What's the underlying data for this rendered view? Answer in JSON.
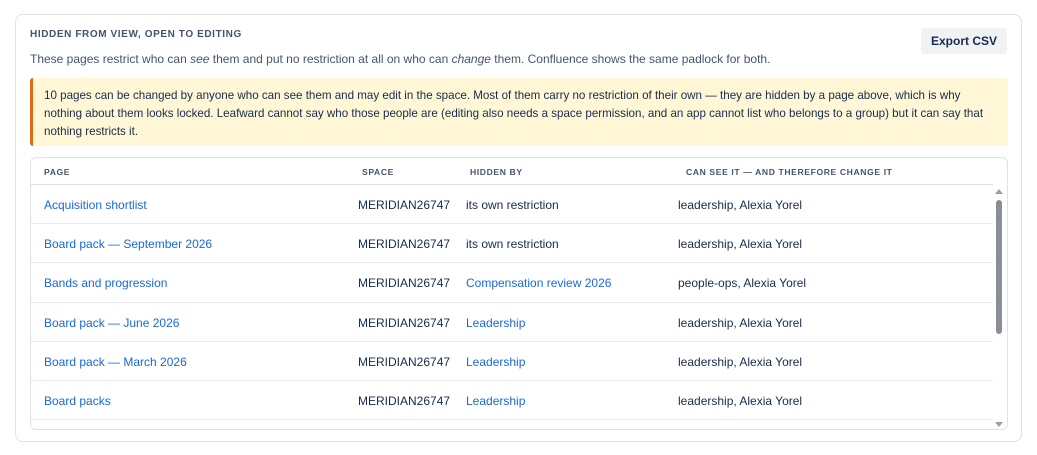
{
  "section": {
    "title": "HIDDEN FROM VIEW, OPEN TO EDITING",
    "desc_before": "These pages restrict who can ",
    "desc_see": "see",
    "desc_middle": " them and put no restriction at all on who can ",
    "desc_change": "change",
    "desc_after": " them. Confluence shows the same padlock for both.",
    "export_label": "Export CSV"
  },
  "warning": {
    "text": "10 pages can be changed by anyone who can see them and may edit in the space. Most of them carry no restriction of their own — they are hidden by a page above, which is why nothing about them looks locked. Leafward cannot say who those people are (editing also needs a space permission, and an app cannot list who belongs to a group) but it can say that nothing restricts it."
  },
  "table": {
    "headers": [
      "PAGE",
      "SPACE",
      "HIDDEN BY",
      "CAN SEE IT — AND THEREFORE CHANGE IT"
    ],
    "rows": [
      {
        "page": "Acquisition shortlist",
        "space": "MERIDIAN26747",
        "hidden_by": "its own restriction",
        "hidden_by_link": false,
        "can_see": "leadership, Alexia Yorel"
      },
      {
        "page": "Board pack — September 2026",
        "space": "MERIDIAN26747",
        "hidden_by": "its own restriction",
        "hidden_by_link": false,
        "can_see": "leadership, Alexia Yorel"
      },
      {
        "page": "Bands and progression",
        "space": "MERIDIAN26747",
        "hidden_by": "Compensation review 2026",
        "hidden_by_link": true,
        "can_see": "people-ops, Alexia Yorel"
      },
      {
        "page": "Board pack — June 2026",
        "space": "MERIDIAN26747",
        "hidden_by": "Leadership",
        "hidden_by_link": true,
        "can_see": "leadership, Alexia Yorel"
      },
      {
        "page": "Board pack — March 2026",
        "space": "MERIDIAN26747",
        "hidden_by": "Leadership",
        "hidden_by_link": true,
        "can_see": "leadership, Alexia Yorel"
      },
      {
        "page": "Board packs",
        "space": "MERIDIAN26747",
        "hidden_by": "Leadership",
        "hidden_by_link": true,
        "can_see": "leadership, Alexia Yorel"
      }
    ]
  },
  "colors": {
    "link": "#1868db",
    "warning_bg": "#fff7d6",
    "warning_border": "#e56910"
  },
  "icons": [
    "scroll-up-arrow-icon",
    "scroll-down-arrow-icon"
  ]
}
